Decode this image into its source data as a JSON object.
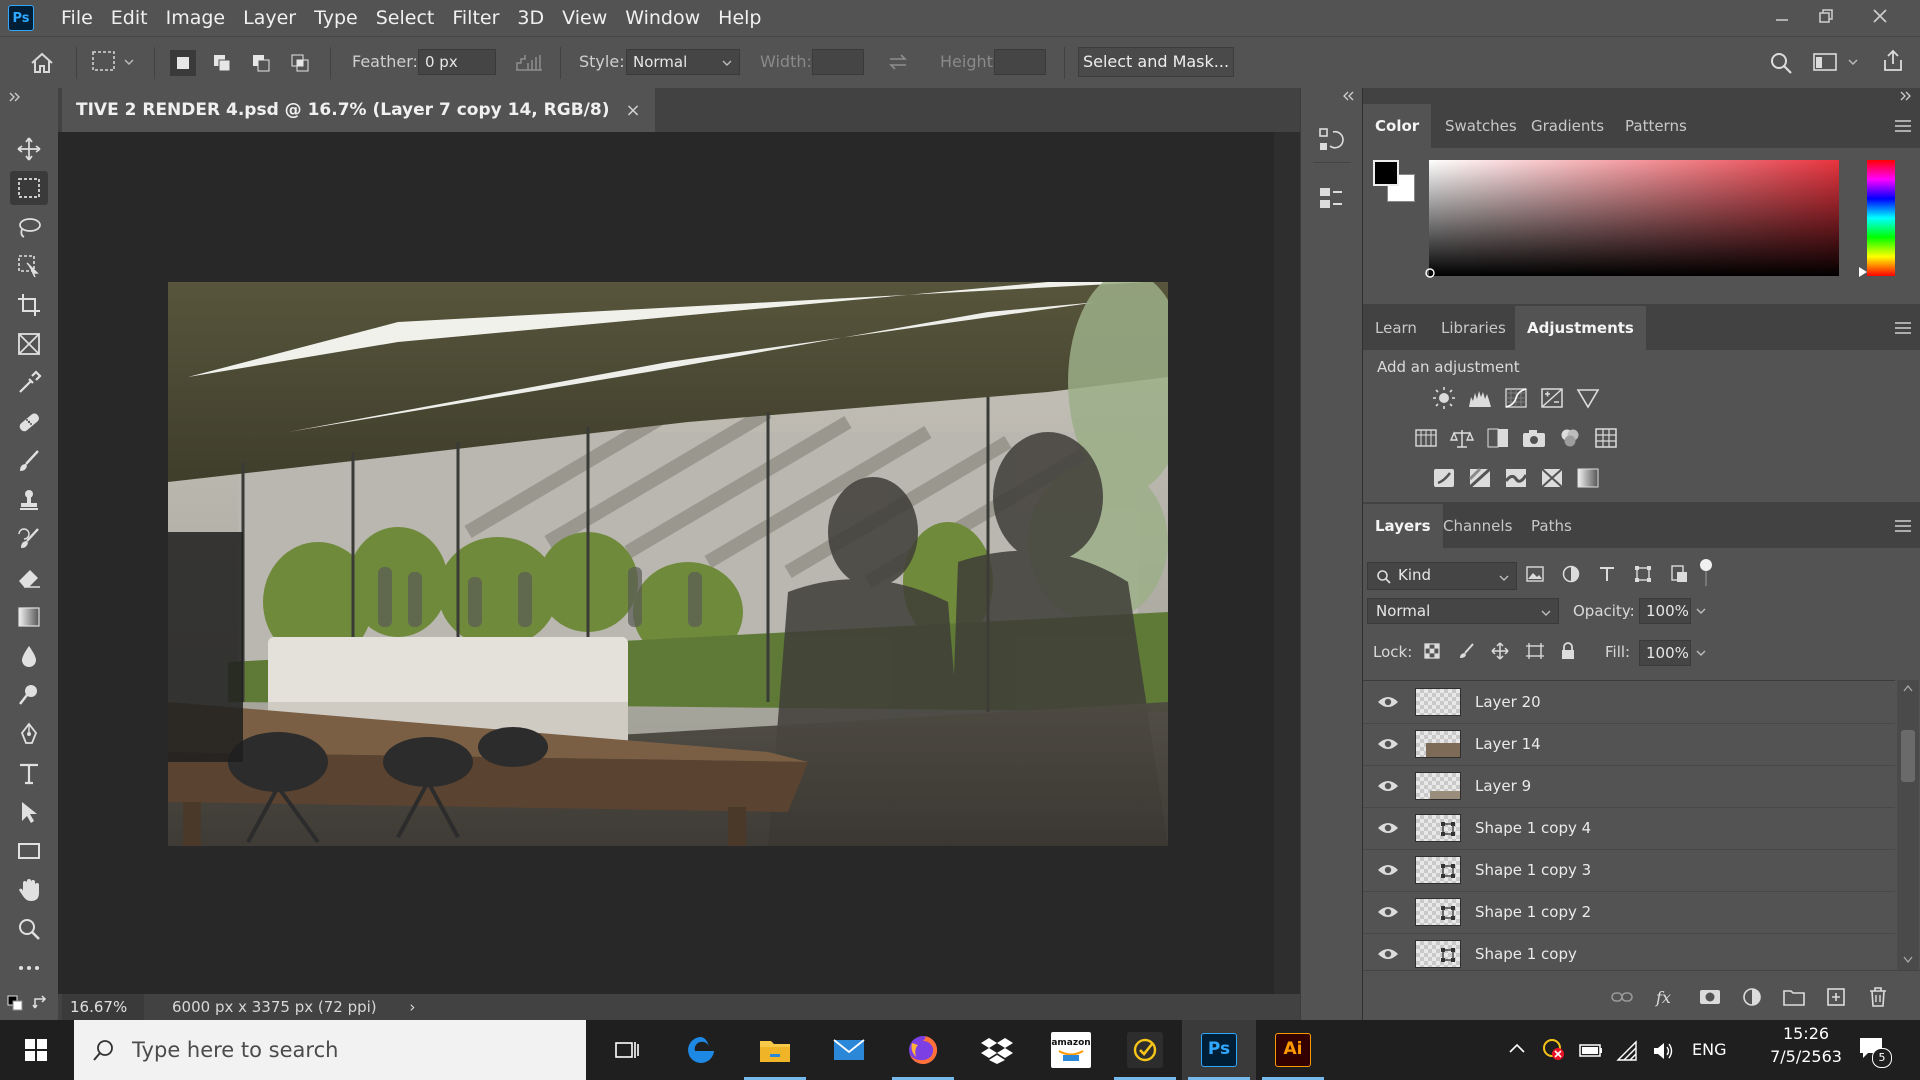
{
  "app": {
    "logo_text": "Ps"
  },
  "menu": [
    "File",
    "Edit",
    "Image",
    "Layer",
    "Type",
    "Select",
    "Filter",
    "3D",
    "View",
    "Window",
    "Help"
  ],
  "options_bar": {
    "feather_label": "Feather:",
    "feather_value": "0 px",
    "style_label": "Style:",
    "style_value": "Normal",
    "width_label": "Width:",
    "height_label": "Height:",
    "select_mask_label": "Select and Mask..."
  },
  "document": {
    "tab_title": "TIVE 2 RENDER 4.psd @ 16.7% (Layer 7 copy 14, RGB/8)",
    "tab_close": "×",
    "zoom": "16.67%",
    "info": "6000 px x 3375 px (72 ppi)",
    "info_arrow": "›"
  },
  "color_panel": {
    "tabs": [
      "Color",
      "Swatches",
      "Gradients",
      "Patterns"
    ],
    "active_tab": "Color",
    "foreground": "#000000",
    "background": "#ffffff",
    "hue_color": "#e8343f"
  },
  "adjust_panel": {
    "tabs": [
      "Learn",
      "Libraries",
      "Adjustments"
    ],
    "active_tab": "Adjustments",
    "heading": "Add an adjustment"
  },
  "layers_panel": {
    "tabs": [
      "Layers",
      "Channels",
      "Paths"
    ],
    "active_tab": "Layers",
    "filter_label": "Kind",
    "blend_mode": "Normal",
    "opacity_label": "Opacity:",
    "opacity_value": "100%",
    "lock_label": "Lock:",
    "fill_label": "Fill:",
    "fill_value": "100%",
    "layers": [
      {
        "name": "Layer 20",
        "type": "pixel"
      },
      {
        "name": "Layer 14",
        "type": "pixel"
      },
      {
        "name": "Layer 9",
        "type": "pixel"
      },
      {
        "name": "Shape 1 copy 4",
        "type": "shape"
      },
      {
        "name": "Shape 1 copy 3",
        "type": "shape"
      },
      {
        "name": "Shape 1 copy 2",
        "type": "shape"
      },
      {
        "name": "Shape 1 copy",
        "type": "shape"
      }
    ]
  },
  "taskbar": {
    "search_placeholder": "Type here to search",
    "apps": [
      "task-view",
      "edge",
      "file-explorer",
      "mail",
      "firefox",
      "dropbox",
      "amazon",
      "norton",
      "photoshop",
      "illustrator"
    ],
    "photoshop_label": "Ps",
    "illustrator_label": "Ai",
    "amazon_label": "amazon",
    "language": "ENG",
    "time": "15:26",
    "date": "7/5/2563",
    "notification_count": "5"
  }
}
